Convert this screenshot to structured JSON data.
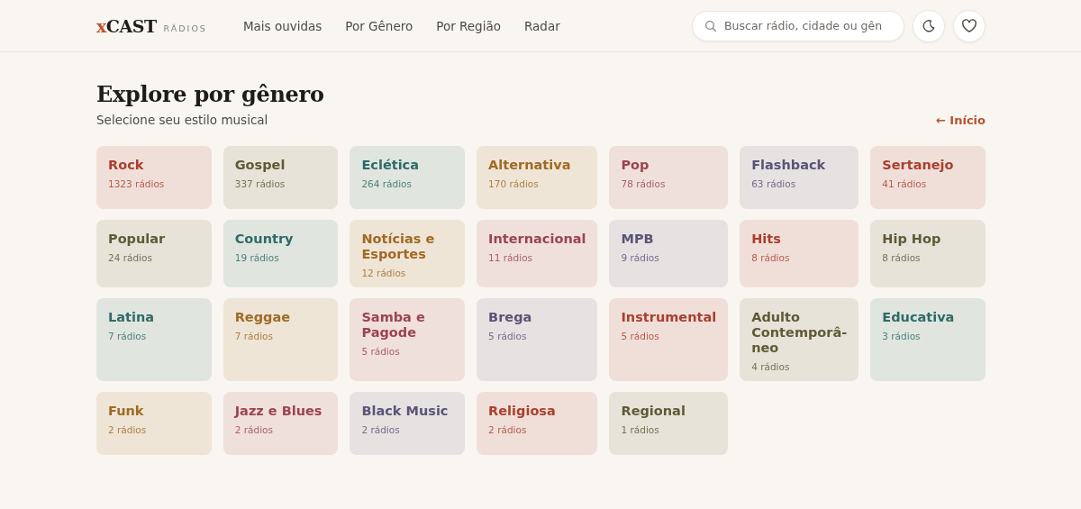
{
  "header": {
    "logo_mark": "x",
    "logo_word": "CAST",
    "logo_sub": "RÁDIOS",
    "nav": [
      {
        "label": "Mais ouvidas"
      },
      {
        "label": "Por Gênero"
      },
      {
        "label": "Por Região"
      },
      {
        "label": "Radar"
      }
    ],
    "search": {
      "placeholder": "Buscar rádio, cidade ou gên"
    }
  },
  "page": {
    "title": "Explore por gênero",
    "subtitle": "Selecione seu estilo musical",
    "back_link": "← Início"
  },
  "genres": [
    {
      "name": "Rock",
      "count": "1323 rádios",
      "color": "#a8402e"
    },
    {
      "name": "Gospel",
      "count": "337 rádios",
      "color": "#5f5a36"
    },
    {
      "name": "Eclética",
      "count": "264 rádios",
      "color": "#2f6b68"
    },
    {
      "name": "Alternativa",
      "count": "170 rádios",
      "color": "#a06a24"
    },
    {
      "name": "Pop",
      "count": "78 rádios",
      "color": "#9c4450"
    },
    {
      "name": "Flashback",
      "count": "63 rádios",
      "color": "#595478"
    },
    {
      "name": "Sertanejo",
      "count": "41 rádios",
      "color": "#a8402e"
    },
    {
      "name": "Popular",
      "count": "24 rádios",
      "color": "#5f5a36"
    },
    {
      "name": "Country",
      "count": "19 rádios",
      "color": "#2f6b68"
    },
    {
      "name": "Notícias e Esportes",
      "count": "12 rádios",
      "color": "#a06a24"
    },
    {
      "name": "Internacional",
      "count": "11 rádios",
      "color": "#9c4450"
    },
    {
      "name": "MPB",
      "count": "9 rádios",
      "color": "#595478"
    },
    {
      "name": "Hits",
      "count": "8 rádios",
      "color": "#a8402e"
    },
    {
      "name": "Hip Hop",
      "count": "8 rádios",
      "color": "#5f5a36"
    },
    {
      "name": "Latina",
      "count": "7 rádios",
      "color": "#2f6b68"
    },
    {
      "name": "Reggae",
      "count": "7 rádios",
      "color": "#a06a24"
    },
    {
      "name": "Samba e Pagode",
      "count": "5 rádios",
      "color": "#9c4450"
    },
    {
      "name": "Brega",
      "count": "5 rádios",
      "color": "#595478"
    },
    {
      "name": "Instrumental",
      "count": "5 rádios",
      "color": "#a8402e"
    },
    {
      "name": "Adulto Contemporâ-neo",
      "count": "4 rádios",
      "color": "#5f5a36"
    },
    {
      "name": "Educativa",
      "count": "3 rádios",
      "color": "#2f6b68"
    },
    {
      "name": "Funk",
      "count": "2 rádios",
      "color": "#a06a24"
    },
    {
      "name": "Jazz e Blues",
      "count": "2 rádios",
      "color": "#9c4450"
    },
    {
      "name": "Black Music",
      "count": "2 rádios",
      "color": "#595478"
    },
    {
      "name": "Religiosa",
      "count": "2 rádios",
      "color": "#a8402e"
    },
    {
      "name": "Regional",
      "count": "1 rádios",
      "color": "#5f5a36"
    }
  ]
}
